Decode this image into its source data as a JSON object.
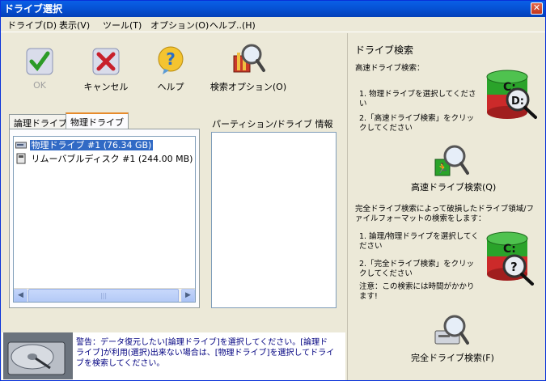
{
  "window": {
    "title": "ドライブ選択",
    "close_glyph": "✕"
  },
  "menu": [
    {
      "label": "ドライブ(D)"
    },
    {
      "label": "表示(V)"
    },
    {
      "label": "ツール(T)"
    },
    {
      "label": "オプション(O)"
    },
    {
      "label": "ヘルプ..(H)"
    }
  ],
  "toolbar": {
    "ok_label": "OK",
    "cancel_label": "キャンセル",
    "help_label": "ヘルプ",
    "search_options_label": "検索オプション(O)"
  },
  "tabs": {
    "logical": "論理ドライブ",
    "physical": "物理ドライブ"
  },
  "drives": [
    {
      "label": "物理ドライブ #1  (76.34 GB)",
      "selected": true
    },
    {
      "label": "リムーバブルディスク #1  (244.00 MB)",
      "selected": false
    }
  ],
  "partition_info_label": "パーティション/ドライブ  情報",
  "warning_text": "警告：データ復元したい[論理ドライブ]を選択してください。[論理ドライブ]が利用(選択)出来ない場合は、[物理ドライブ]を選択してドライブを検索してください。",
  "right": {
    "title": "ドライブ検索",
    "fast_heading": "高速ドライブ検索：",
    "fast_step1": "1. 物理ドライブを選択してください",
    "fast_step2": "2.「高速ドライブ検索」をクリックしてください",
    "fast_button": "高速ドライブ検索(Q)",
    "full_desc": "完全ドライブ検索によって破損したドライブ領域/ファイルフォーマットの検索をします：",
    "full_step1": "1. 論理/物理ドライブを選択してください",
    "full_step2": "2.「完全ドライブ検索」をクリックしてください",
    "full_note": "注意：この検索には時間がかかります!",
    "full_button": "完全ドライブ検索(F)",
    "drive_c": "C:",
    "drive_d": "D:",
    "drive_q": "?"
  },
  "colors": {
    "title_blue": "#0654d8",
    "selection": "#316ac5",
    "warning_text": "#000080"
  }
}
